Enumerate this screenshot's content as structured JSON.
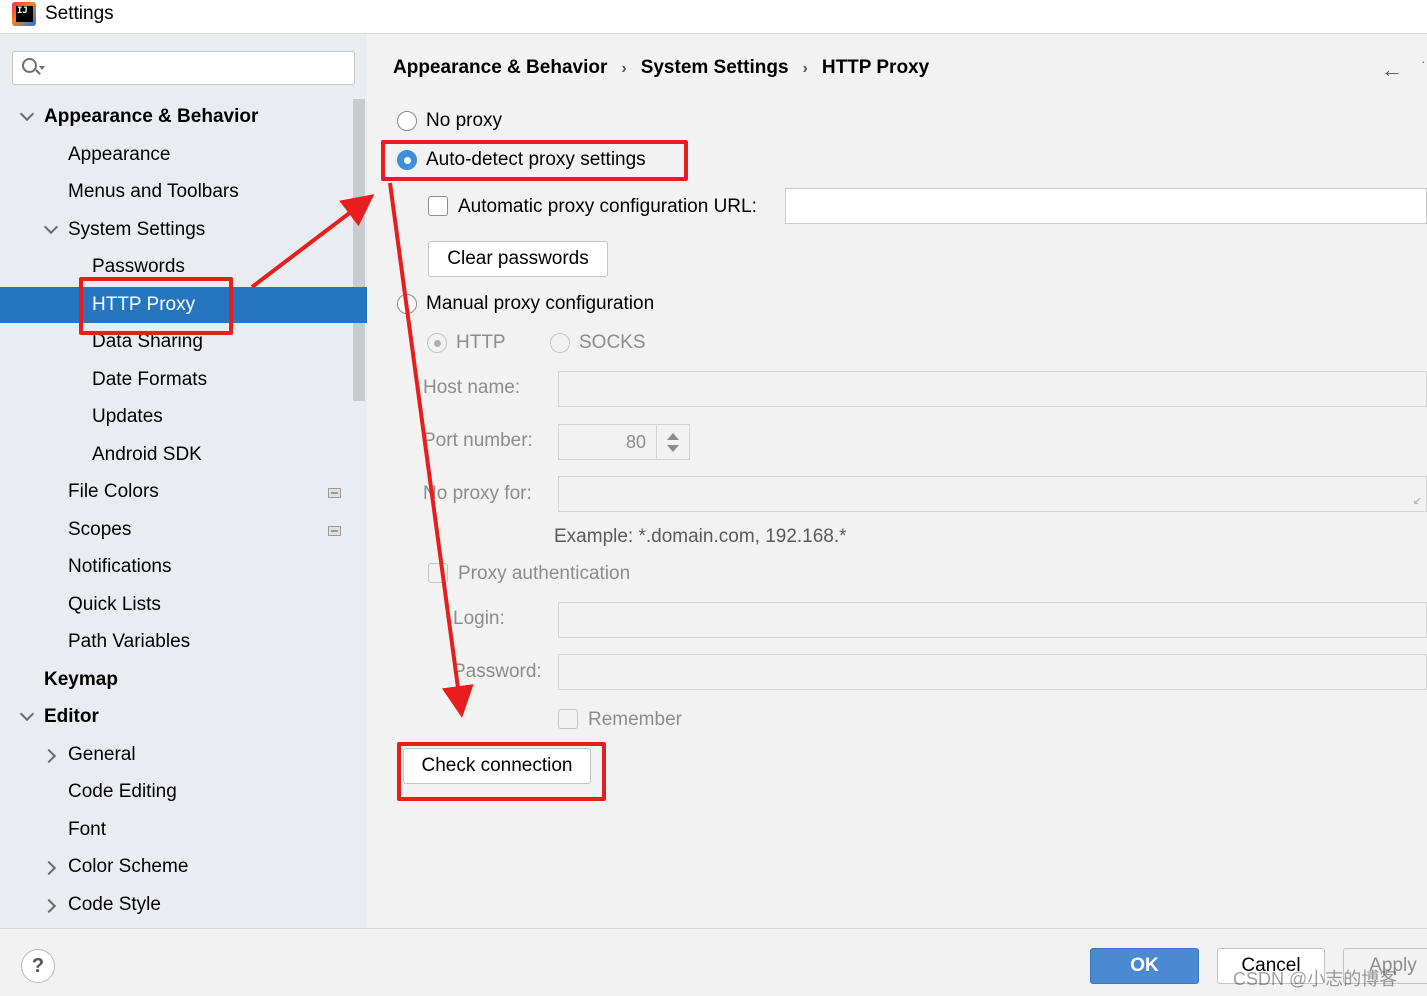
{
  "window": {
    "title": "Settings"
  },
  "search": {
    "placeholder": "",
    "value": ""
  },
  "sidebar": {
    "items": [
      {
        "label": "Appearance & Behavior",
        "bold": true,
        "arrow": "down"
      },
      {
        "label": "Appearance"
      },
      {
        "label": "Menus and Toolbars"
      },
      {
        "label": "System Settings",
        "arrow": "down"
      },
      {
        "label": "Passwords"
      },
      {
        "label": "HTTP Proxy",
        "selected": true
      },
      {
        "label": "Data Sharing"
      },
      {
        "label": "Date Formats"
      },
      {
        "label": "Updates"
      },
      {
        "label": "Android SDK"
      },
      {
        "label": "File Colors",
        "icon": "project-scope-icon"
      },
      {
        "label": "Scopes",
        "icon": "project-scope-icon"
      },
      {
        "label": "Notifications"
      },
      {
        "label": "Quick Lists"
      },
      {
        "label": "Path Variables"
      },
      {
        "label": "Keymap",
        "bold": true
      },
      {
        "label": "Editor",
        "bold": true,
        "arrow": "down"
      },
      {
        "label": "General",
        "arrow": "right"
      },
      {
        "label": "Code Editing"
      },
      {
        "label": "Font"
      },
      {
        "label": "Color Scheme",
        "arrow": "right"
      },
      {
        "label": "Code Style",
        "arrow": "right"
      }
    ]
  },
  "breadcrumb": {
    "items": [
      "Appearance & Behavior",
      "System Settings",
      "HTTP Proxy"
    ],
    "separator": "›"
  },
  "proxy": {
    "no_proxy": "No proxy",
    "auto_detect": "Auto-detect proxy settings",
    "auto_config_url": "Automatic proxy configuration URL:",
    "clear_passwords": "Clear passwords",
    "manual": "Manual proxy configuration",
    "http": "HTTP",
    "socks": "SOCKS",
    "host_name": "Host name:",
    "port_number": "Port number:",
    "port_value": "80",
    "no_proxy_for": "No proxy for:",
    "example": "Example: *.domain.com, 192.168.*",
    "proxy_auth": "Proxy authentication",
    "login": "Login:",
    "password": "Password:",
    "remember": "Remember",
    "check_connection": "Check connection",
    "selected_option": "Auto-detect proxy settings"
  },
  "footer": {
    "help": "?",
    "ok": "OK",
    "cancel": "Cancel",
    "apply": "Apply",
    "watermark": "CSDN @小志的博客"
  },
  "colors": {
    "selection": "#2675bf",
    "annotation": "#e81e1e",
    "primary_button": "#4a8ad2"
  }
}
